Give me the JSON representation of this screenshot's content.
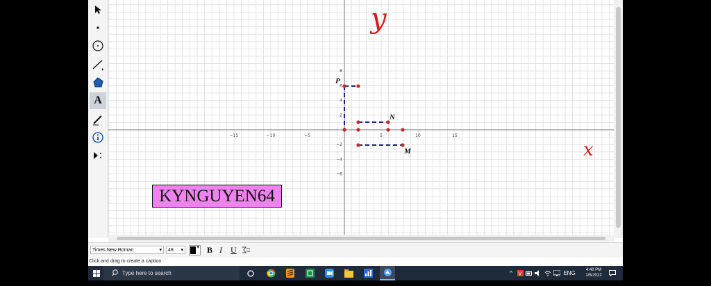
{
  "toolbar": {
    "tools": [
      {
        "name": "move-tool",
        "icon": "arrow-icon"
      },
      {
        "name": "point-tool",
        "icon": "point-icon"
      },
      {
        "name": "circle-tool",
        "icon": "circle-icon"
      },
      {
        "name": "line-tool",
        "icon": "line-icon"
      },
      {
        "name": "polygon-tool",
        "icon": "polygon-icon"
      },
      {
        "name": "text-tool",
        "icon": "text-A-icon",
        "label": "A",
        "active": true
      },
      {
        "name": "pen-tool",
        "icon": "pen-icon"
      },
      {
        "name": "info-tool",
        "icon": "info-icon"
      },
      {
        "name": "custom-tools",
        "icon": "play-more-icon"
      }
    ]
  },
  "graph": {
    "x_ticks": [
      "−15",
      "−10",
      "−5",
      "5",
      "10",
      "15"
    ],
    "y_ticks": [
      "8",
      "6",
      "4",
      "2",
      "−2",
      "−4",
      "−6"
    ],
    "points": {
      "P": "P",
      "N": "N",
      "M": "M"
    },
    "handwriting": {
      "y": "y",
      "x": "x"
    },
    "ink_color": "#d41a1a",
    "point_color": "#c62828",
    "segment_color": "#1a237e"
  },
  "caption": {
    "text": "KYNGUYEN64",
    "background": "#ee82ee"
  },
  "stylebar": {
    "font_family": "Times New Roman",
    "font_size": "48",
    "bold": "B",
    "italic": "I",
    "underline": "U"
  },
  "status": {
    "text": "Click and drag to create a caption"
  },
  "taskbar": {
    "search_placeholder": "Type here to search",
    "language": "ENG",
    "time": "4:48 PM",
    "date": "1/5/2022"
  }
}
